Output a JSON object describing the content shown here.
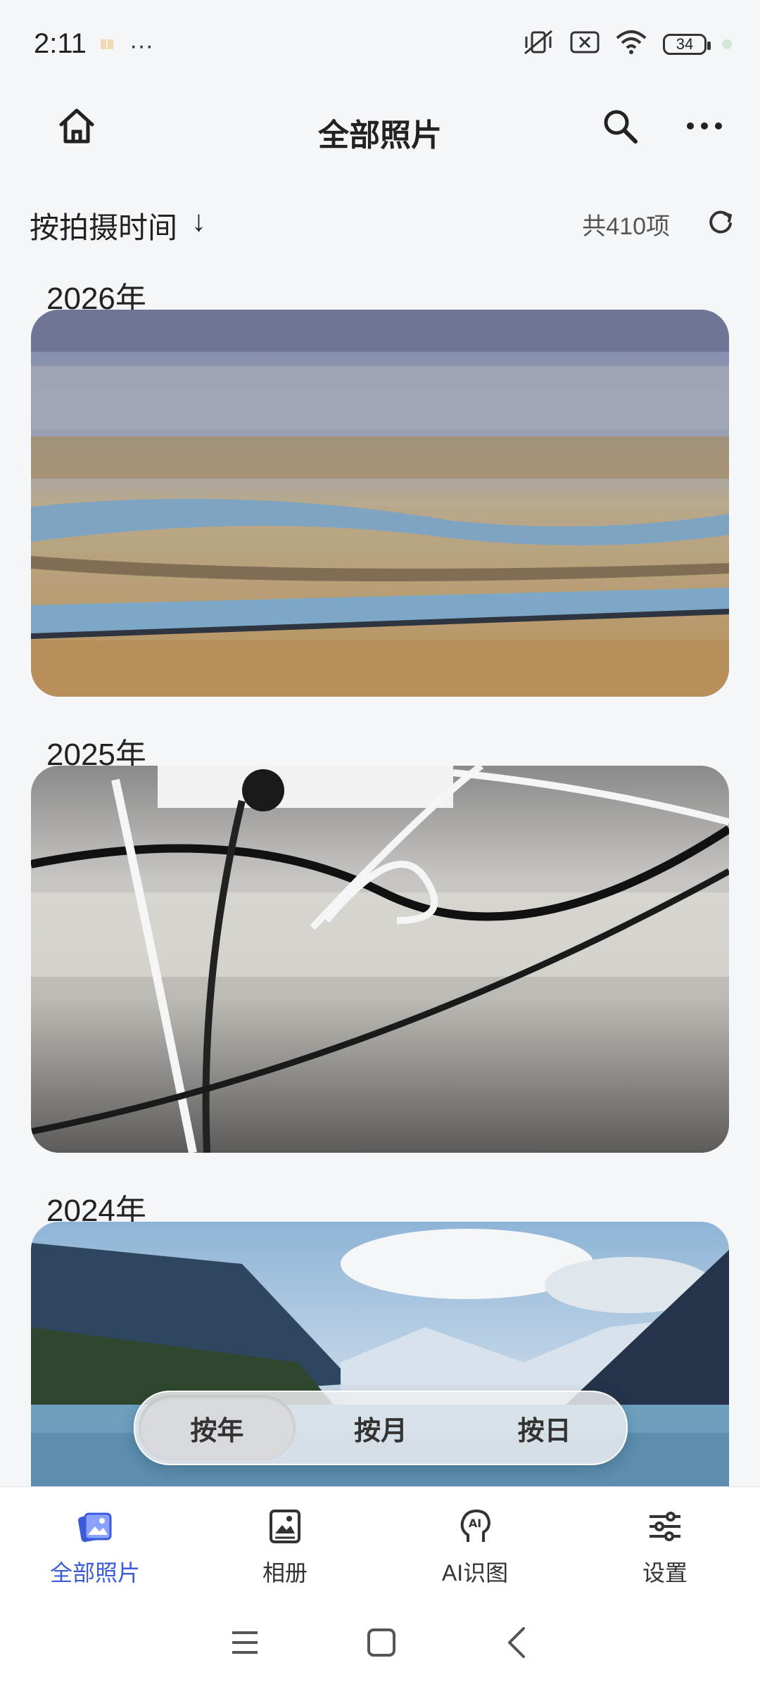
{
  "status_bar": {
    "time": "2:11",
    "more": "···",
    "battery": "34"
  },
  "app_bar": {
    "title": "全部照片"
  },
  "sort": {
    "label": "按拍摄时间",
    "direction_glyph": "↓",
    "count": "共410项"
  },
  "sections": [
    {
      "year": "2026年",
      "photo": "landscape-river"
    },
    {
      "year": "2025年",
      "photo": "cables-desk"
    },
    {
      "year": "2024年",
      "photo": "mountain-lake"
    }
  ],
  "segment": {
    "items": [
      "按年",
      "按月",
      "按日"
    ],
    "selected": 0
  },
  "bottom_nav": {
    "items": [
      {
        "label": "全部照片",
        "icon": "photos-icon"
      },
      {
        "label": "相册",
        "icon": "album-icon"
      },
      {
        "label": "AI识图",
        "icon": "ai-recognize-icon"
      },
      {
        "label": "设置",
        "icon": "settings-sliders-icon"
      }
    ],
    "active": 0
  },
  "colors": {
    "accent": "#3b5bdb",
    "background": "#f5f6f8"
  }
}
